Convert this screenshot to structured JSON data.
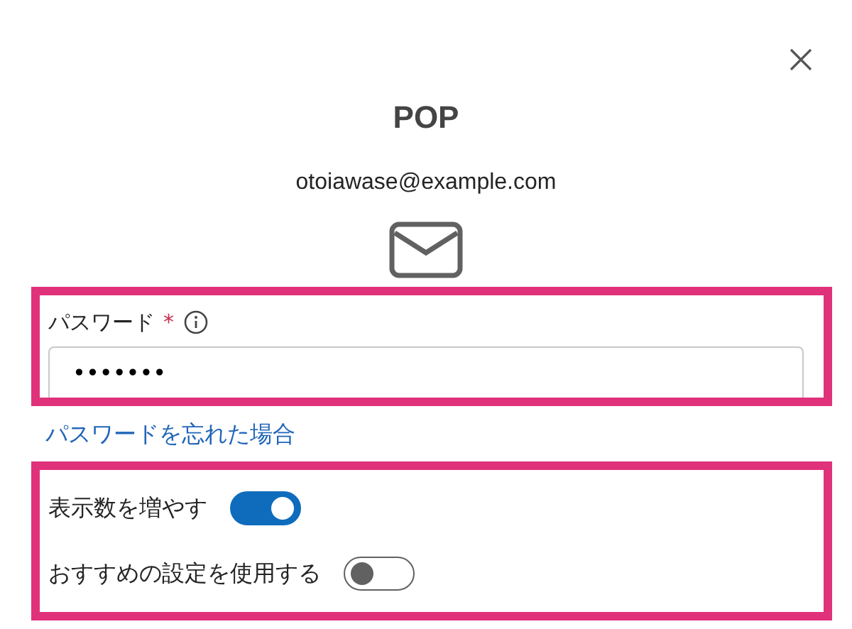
{
  "dialog": {
    "title": "POP",
    "account": "otoiawase@example.com"
  },
  "password": {
    "label": "パスワード",
    "required_mark": "*",
    "value": "•••••••",
    "highlighted": true
  },
  "forgot_link": "パスワードを忘れた場合",
  "options": {
    "highlighted": true,
    "toggles": [
      {
        "label": "表示数を増やす",
        "on": true
      },
      {
        "label": "おすすめの設定を使用する",
        "on": false
      }
    ]
  }
}
